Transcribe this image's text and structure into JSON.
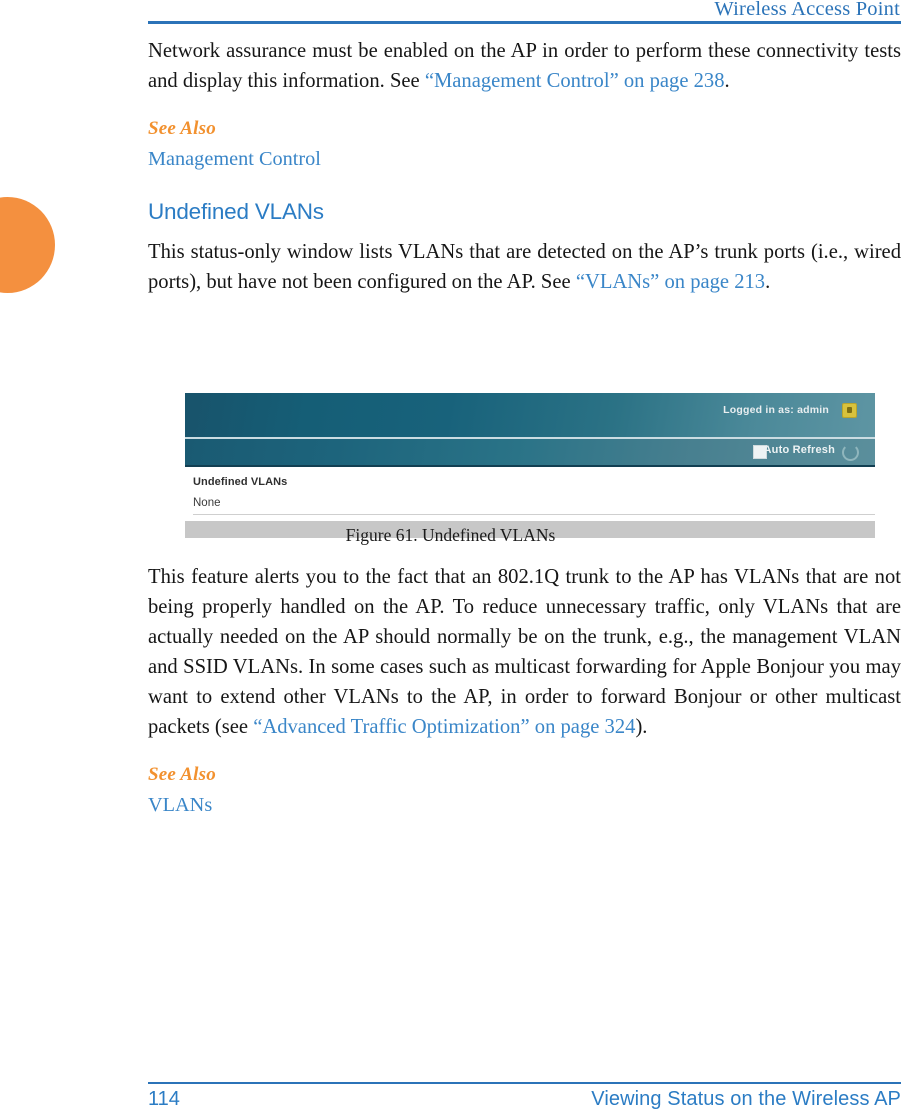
{
  "header": {
    "title": "Wireless Access Point",
    "rule_color": "#2b73b8"
  },
  "thumb_tab": {
    "color": "#f4903f"
  },
  "intro_paragraph": {
    "text_before": "Network assurance must be enabled on the AP in order to perform these connectivity tests and display this information. See ",
    "link": "“Management Control” on page 238",
    "text_after": "."
  },
  "see_also_1": {
    "label": "See Also",
    "links": [
      "Management Control"
    ]
  },
  "section": {
    "heading": "Undefined VLANs",
    "paragraph_before": "This status-only window lists VLANs that are detected on the AP’s trunk ports (i.e., wired ports), but have not been configured on the AP. See ",
    "paragraph_link": "“VLANs” on page 213",
    "paragraph_after": "."
  },
  "figure": {
    "caption": "Figure 61. Undefined VLANs",
    "screenshot": {
      "logged_in": "Logged in as: admin",
      "lock_icon": "lock-icon",
      "auto_refresh_label": "Auto Refresh",
      "auto_refresh_checked": false,
      "refresh_icon": "refresh-icon",
      "panel_heading": "Undefined VLANs",
      "panel_value": "None",
      "header_color": "#18627b",
      "footer_bar_color": "#c7c7c7"
    }
  },
  "detail_paragraph": {
    "text_before": "This feature alerts you to the fact that an 802.1Q trunk to the AP has VLANs that are not being properly handled on the AP. To reduce unnecessary traffic, only VLANs that are actually needed on the AP should normally be on the trunk, e.g., the management VLAN and SSID VLANs. In some cases such as multicast forwarding for Apple Bonjour you may want to extend other VLANs to the AP, in order to forward Bonjour or other multicast packets (see ",
    "link": "“Advanced Traffic Optimization” on page 324",
    "text_after": ")."
  },
  "see_also_2": {
    "label": "See Also",
    "links": [
      "VLANs"
    ]
  },
  "footer": {
    "page_number": "114",
    "text": "Viewing Status on the Wireless AP",
    "rule_color": "#2b73b8"
  },
  "colors": {
    "link": "#3a86c8",
    "accent_orange": "#f2912f",
    "heading_blue": "#2b7cc4",
    "body": "#161616"
  }
}
